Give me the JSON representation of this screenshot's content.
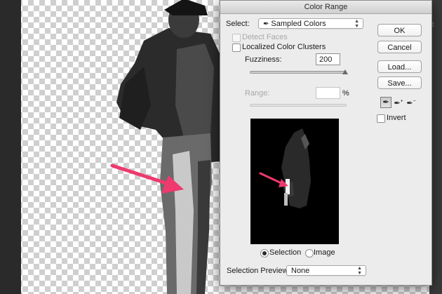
{
  "dialog": {
    "title": "Color Range",
    "select_label": "Select:",
    "select_value": "Sampled Colors",
    "select_icon": "eyedropper-icon",
    "detect_faces_label": "Detect Faces",
    "detect_faces_checked": false,
    "detect_faces_enabled": false,
    "localized_label": "Localized Color Clusters",
    "localized_checked": false,
    "fuzziness_label": "Fuzziness:",
    "fuzziness_value": "200",
    "fuzziness_level": 1.0,
    "range_label": "Range:",
    "range_value": "",
    "range_unit": "%",
    "range_enabled": false,
    "radio_selection_label": "Selection",
    "radio_image_label": "Image",
    "radio_selected": "Selection",
    "preview_label": "Selection Preview:",
    "preview_value": "None",
    "buttons": {
      "ok": "OK",
      "cancel": "Cancel",
      "load": "Load...",
      "save": "Save..."
    },
    "tools": [
      "eyedropper-icon",
      "eyedropper-plus-icon",
      "eyedropper-minus-icon"
    ],
    "active_tool": "eyedropper-icon",
    "invert_label": "Invert",
    "invert_checked": false
  },
  "colors": {
    "annotation_arrow": "#ee3a6e",
    "dialog_bg": "#ececec",
    "preview_bg": "#000000"
  }
}
